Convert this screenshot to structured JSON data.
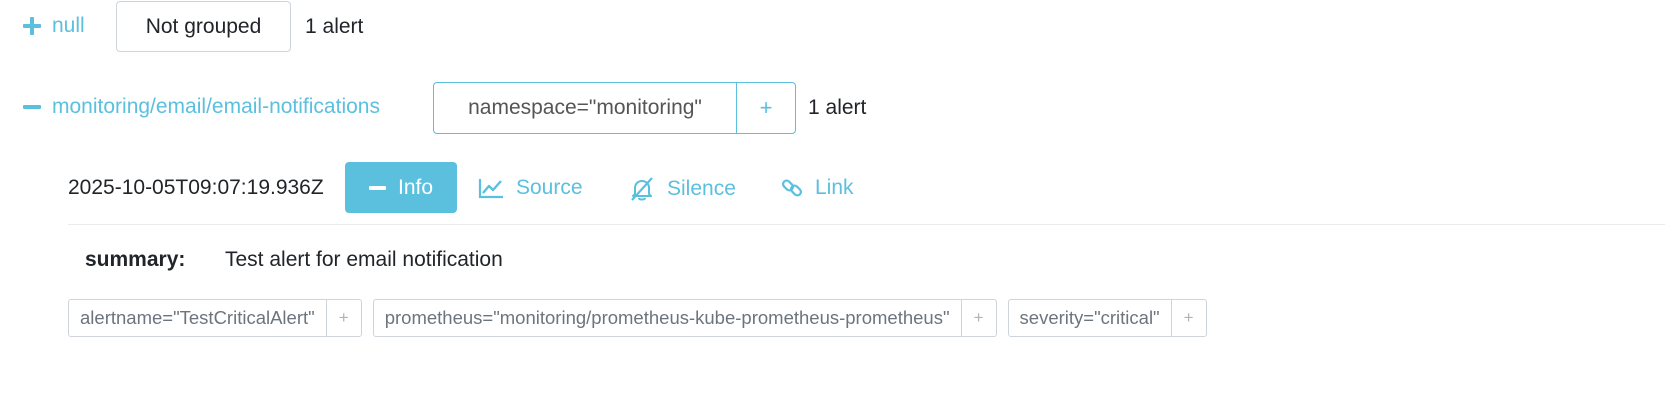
{
  "groups": [
    {
      "toggle": "expand",
      "label": "null",
      "grouping_chip": "Not grouped",
      "count": "1 alert"
    },
    {
      "toggle": "collapse",
      "label": "monitoring/email/email-notifications",
      "filter_label": "namespace=\"monitoring\"",
      "filter_add": "+",
      "count": "1 alert"
    }
  ],
  "alert": {
    "timestamp": "2025-10-05T09:07:19.936Z",
    "actions": {
      "info": "Info",
      "source": "Source",
      "silence": "Silence",
      "link": "Link"
    },
    "annotations": {
      "summary_key": "summary:",
      "summary_value": "Test alert for email notification"
    },
    "labels": [
      {
        "text": "alertname=\"TestCriticalAlert\"",
        "add": "+"
      },
      {
        "text": "prometheus=\"monitoring/prometheus-kube-prometheus-prometheus\"",
        "add": "+"
      },
      {
        "text": "severity=\"critical\"",
        "add": "+"
      }
    ]
  },
  "colors": {
    "accent": "#5bc0de",
    "text": "#212529",
    "muted": "#6c757d",
    "border": "#ced4da"
  },
  "icons": [
    "plus-icon",
    "minus-icon",
    "chart-line-icon",
    "bell-slash-icon",
    "link-icon"
  ]
}
